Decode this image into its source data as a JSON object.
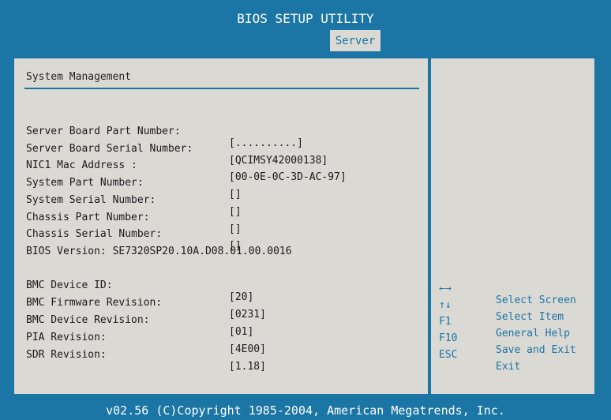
{
  "window": {
    "title": "BIOS SETUP UTILITY"
  },
  "tabs": [
    {
      "label": "Server",
      "active": true
    }
  ],
  "section": {
    "title": "System Management"
  },
  "fields": [
    {
      "label": "Server Board Part Number:",
      "value": "[..........]"
    },
    {
      "label": "Server Board Serial Number:",
      "value": "[QCIMSY42000138]"
    },
    {
      "label": "NIC1 Mac Address :",
      "value": "[00-0E-0C-3D-AC-97]"
    },
    {
      "label": "System Part Number:",
      "value": "[]"
    },
    {
      "label": "System Serial Number:",
      "value": "[]"
    },
    {
      "label": "Chassis Part Number:",
      "value": "[]"
    },
    {
      "label": "Chassis Serial Number:",
      "value": "[]"
    }
  ],
  "bios_version": "BIOS Version: SE7320SP20.10A.D08.01.00.0016",
  "bmc_fields": [
    {
      "label": "BMC Device ID:",
      "value": "[20]"
    },
    {
      "label": "BMC Firmware Revision:",
      "value": "[0231]"
    },
    {
      "label": "BMC Device Revision:",
      "value": "[01]"
    },
    {
      "label": "PIA Revision:",
      "value": "[4E00]"
    },
    {
      "label": "SDR Revision:",
      "value": "[1.18]"
    }
  ],
  "help": [
    {
      "key": "←→",
      "desc": "Select Screen"
    },
    {
      "key": "↑↓",
      "desc": "Select Item"
    },
    {
      "key": "F1",
      "desc": "General Help"
    },
    {
      "key": "F10",
      "desc": "Save and Exit"
    },
    {
      "key": "ESC",
      "desc": "Exit"
    }
  ],
  "footer": {
    "text": "v02.56 (C)Copyright 1985-2004, American Megatrends, Inc."
  },
  "colors": {
    "background": "#1b75a5",
    "panel": "#dbd9d4",
    "accent_text": "#1b75a5"
  }
}
